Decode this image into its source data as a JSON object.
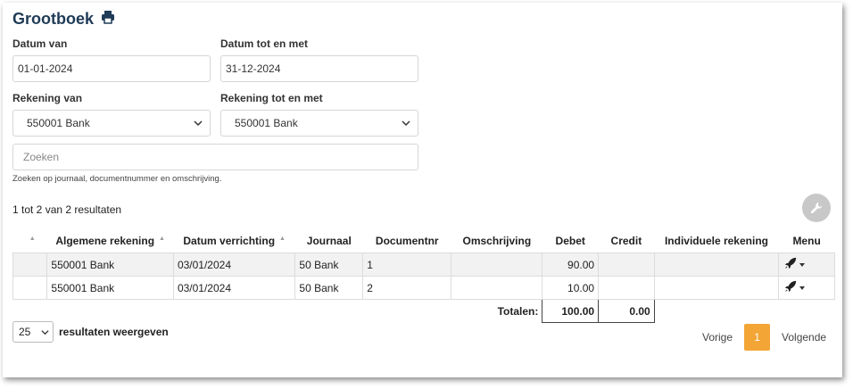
{
  "page": {
    "title": "Grootboek",
    "print_icon": "printer-icon"
  },
  "filters": {
    "datum_van": {
      "label": "Datum van",
      "value": "01-01-2024"
    },
    "datum_tot": {
      "label": "Datum tot en met",
      "value": "31-12-2024"
    },
    "rekening_van": {
      "label": "Rekening van",
      "value": "550001 Bank"
    },
    "rekening_tot": {
      "label": "Rekening tot en met",
      "value": "550001 Bank"
    },
    "search": {
      "placeholder": "Zoeken",
      "hint": "Zoeken op journaal, documentnummer en omschrijving."
    }
  },
  "results": {
    "count_text": "1 tot 2 van 2 resultaten",
    "tools_icon": "wrench-icon"
  },
  "table": {
    "columns": [
      "",
      "Algemene rekening",
      "Datum verrichting",
      "Journaal",
      "Documentnr",
      "Omschrijving",
      "Debet",
      "Credit",
      "Individuele rekening",
      "Menu"
    ],
    "rows": [
      {
        "rekening": "550001 Bank",
        "datum": "03/01/2024",
        "journaal": "50 Bank",
        "documentnr": "1",
        "omschrijving": "",
        "debet": "90.00",
        "credit": "",
        "individueel": ""
      },
      {
        "rekening": "550001 Bank",
        "datum": "03/01/2024",
        "journaal": "50 Bank",
        "documentnr": "2",
        "omschrijving": "",
        "debet": "10.00",
        "credit": "",
        "individueel": ""
      }
    ],
    "totals": {
      "label": "Totalen:",
      "debet": "100.00",
      "credit": "0.00"
    },
    "row_menu_icon": "rocket-icon"
  },
  "footer": {
    "page_size": "25",
    "page_size_label": "resultaten weergeven",
    "prev": "Vorige",
    "current_page": "1",
    "next": "Volgende"
  }
}
